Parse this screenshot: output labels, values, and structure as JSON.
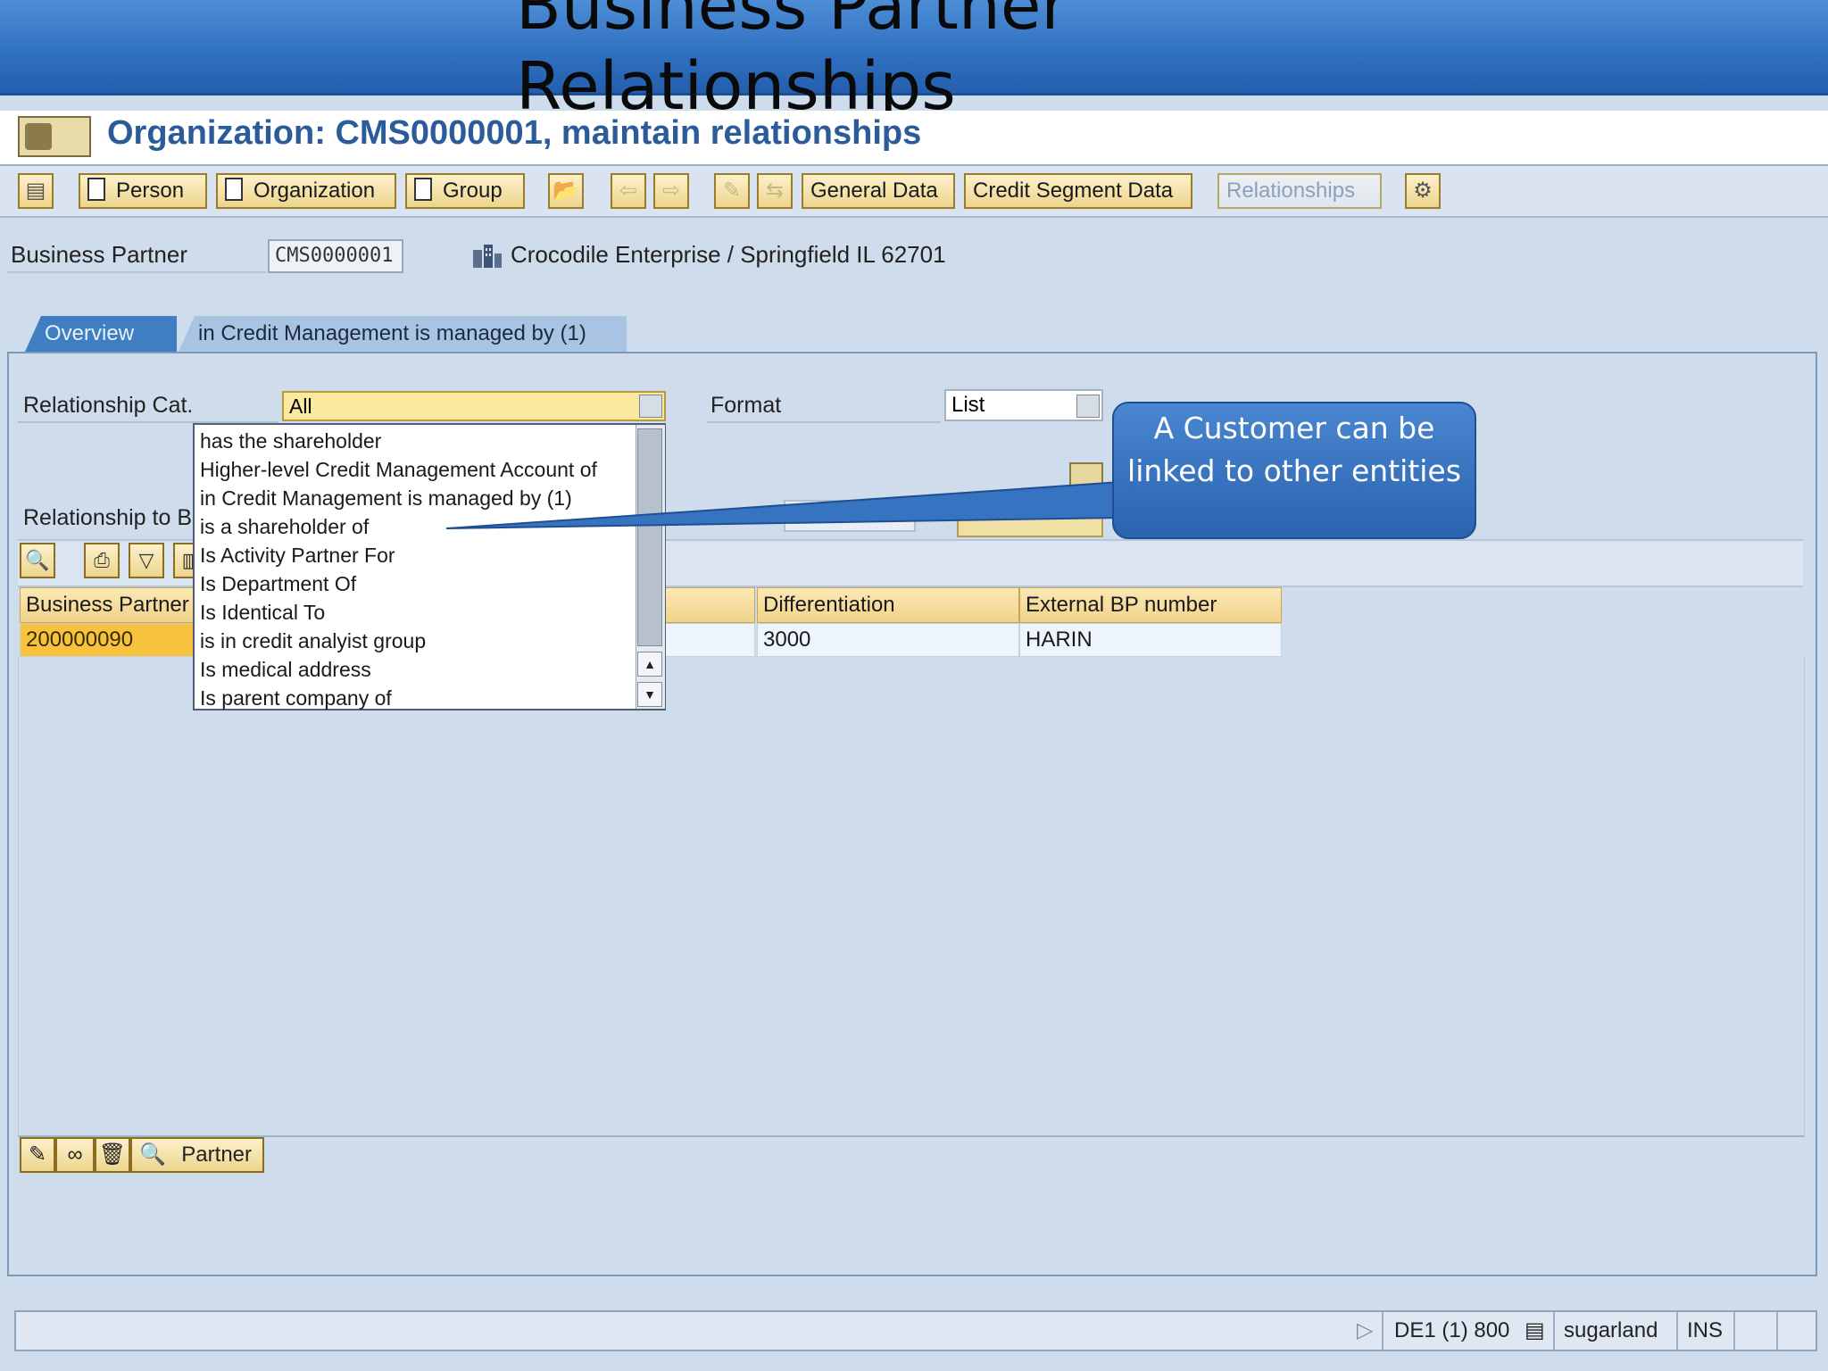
{
  "slide": {
    "title": "Business Partner Relationships"
  },
  "window": {
    "title": "Organization: CMS0000001, maintain relationships"
  },
  "toolbar": {
    "person": "Person",
    "organization": "Organization",
    "group": "Group",
    "general_data": "General Data",
    "credit_segment_data": "Credit Segment Data",
    "relationships": "Relationships"
  },
  "business_partner": {
    "label": "Business Partner",
    "value": "CMS0000001",
    "description": "Crocodile Enterprise / Springfield IL 62701"
  },
  "tabs": [
    {
      "label": "Overview"
    },
    {
      "label": "in Credit Management is managed by (1)"
    }
  ],
  "filters": {
    "relationship_cat_label": "Relationship Cat.",
    "relationship_cat_value": "All",
    "format_label": "Format",
    "format_value": "List",
    "relationship_to_label": "Relationship to B"
  },
  "dropdown": {
    "options": [
      "has the shareholder",
      "Higher-level Credit Management Account of",
      "in Credit Management is managed by (1)",
      "is a shareholder of",
      "Is Activity Partner For",
      "Is Department Of",
      "Is Identical To",
      "is in credit analyist group",
      "Is medical address",
      "Is parent company of"
    ]
  },
  "table": {
    "columns": [
      "Business Partner",
      "Differentiation",
      "External BP number"
    ],
    "rows": [
      {
        "business_partner": "200000090",
        "differentiation": "3000",
        "external_bp_number": "HARIN"
      }
    ]
  },
  "bottom": {
    "partner_label": "Partner"
  },
  "callout": {
    "text": "A Customer can be linked to other entities"
  },
  "status": {
    "system": "DE1 (1) 800",
    "server": "sugarland",
    "mode": "INS"
  },
  "colors": {
    "banner": "#2f6fc0",
    "title": "#2b5c99",
    "highlight": "#f7c33d",
    "field": "#fbe9a0"
  }
}
